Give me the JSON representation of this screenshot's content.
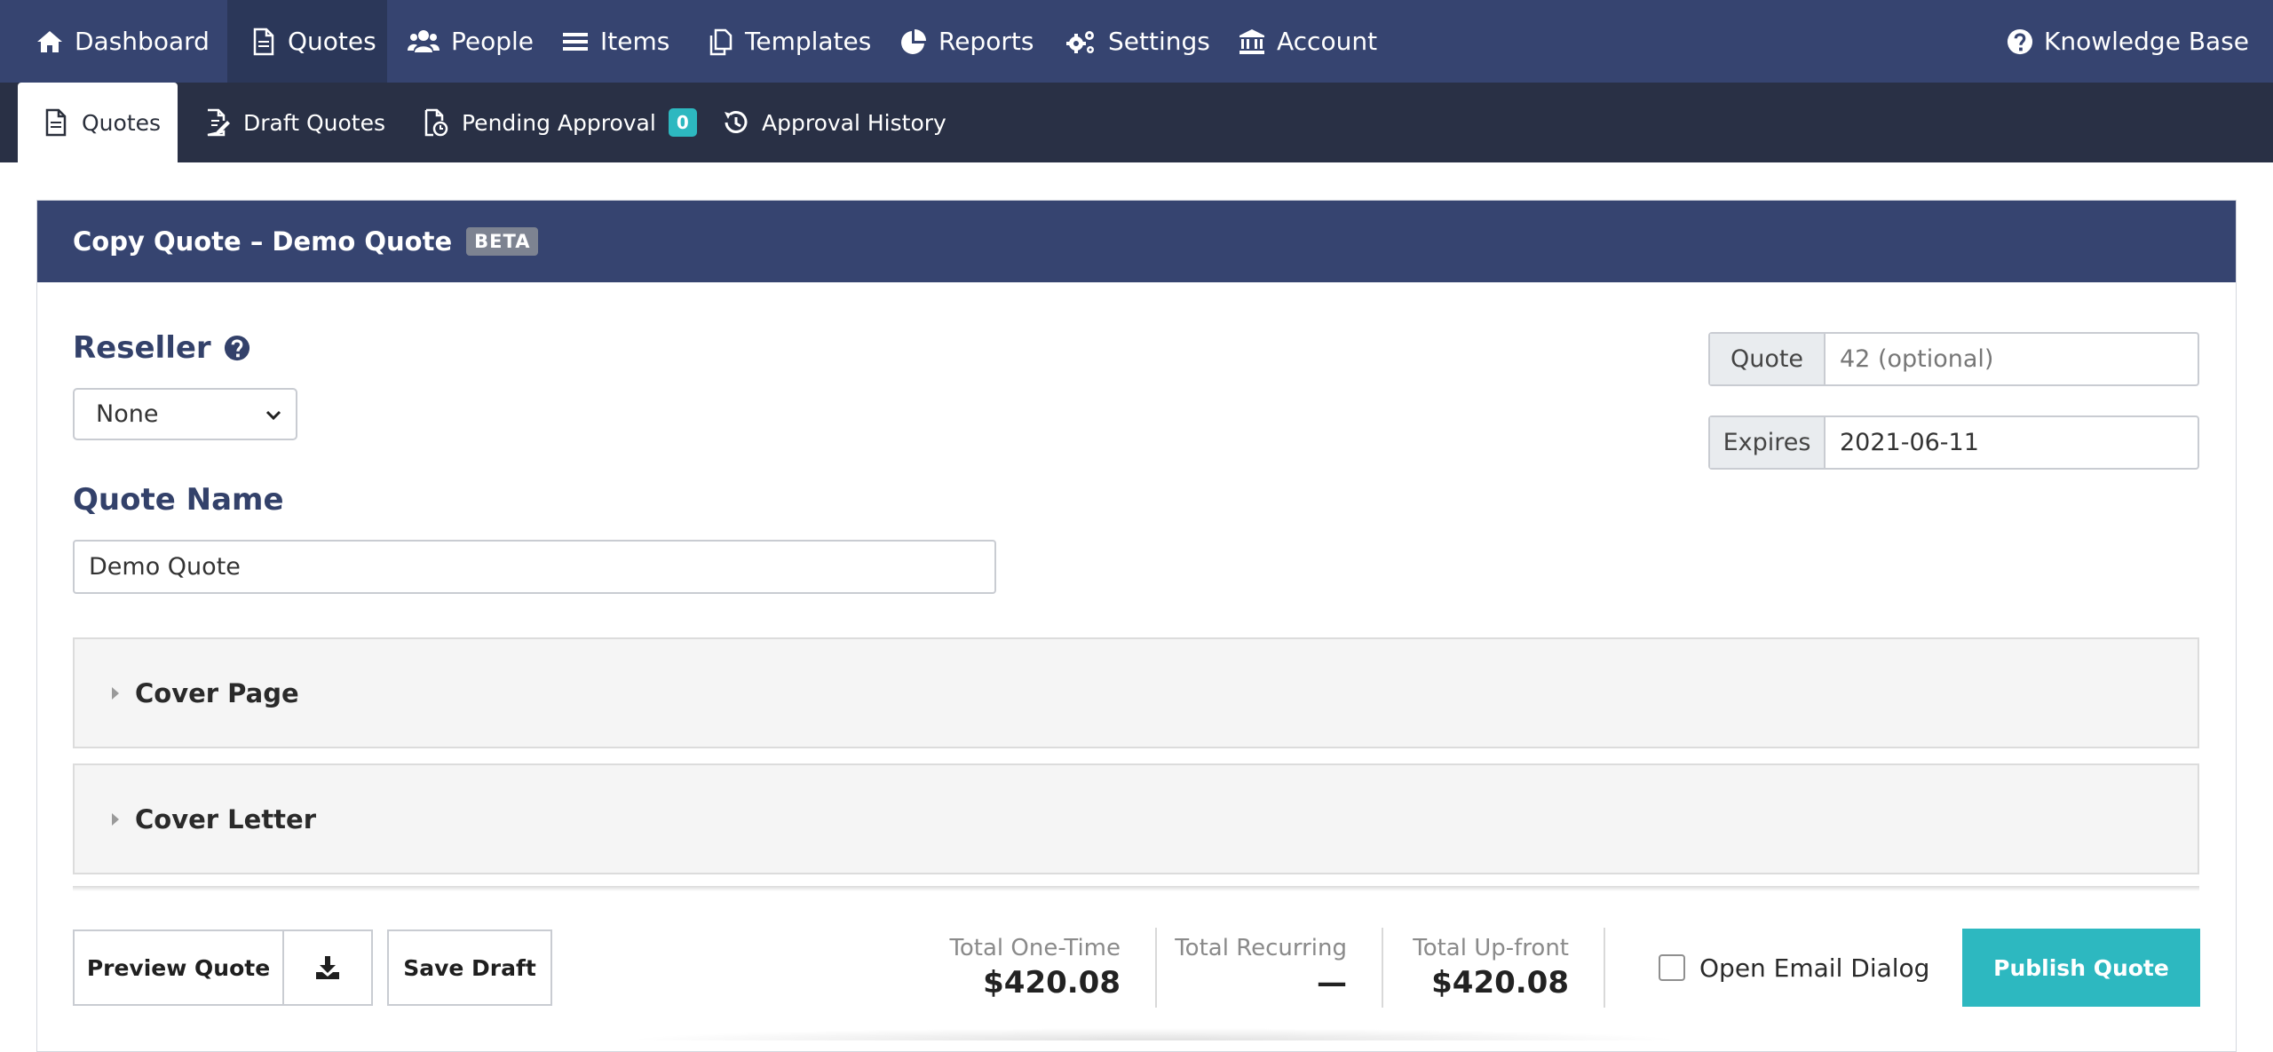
{
  "topnav": {
    "items": [
      {
        "label": "Dashboard",
        "icon": "home-icon"
      },
      {
        "label": "Quotes",
        "icon": "document-icon"
      },
      {
        "label": "People",
        "icon": "users-icon"
      },
      {
        "label": "Items",
        "icon": "list-icon"
      },
      {
        "label": "Templates",
        "icon": "copy-icon"
      },
      {
        "label": "Reports",
        "icon": "pie-chart-icon"
      },
      {
        "label": "Settings",
        "icon": "gears-icon"
      },
      {
        "label": "Account",
        "icon": "bank-icon"
      }
    ],
    "active": "Quotes",
    "knowledge_base": "Knowledge Base"
  },
  "subnav": {
    "items": [
      {
        "label": "Quotes",
        "icon": "document-icon"
      },
      {
        "label": "Draft Quotes",
        "icon": "edit-document-icon"
      },
      {
        "label": "Pending Approval",
        "icon": "clock-document-icon",
        "badge": "0"
      },
      {
        "label": "Approval History",
        "icon": "history-icon"
      }
    ],
    "active": "Quotes"
  },
  "card": {
    "title": "Copy Quote – Demo Quote",
    "beta": "BETA"
  },
  "form": {
    "reseller_label": "Reseller",
    "reseller_value": "None",
    "quote_name_label": "Quote Name",
    "quote_name_value": "Demo Quote",
    "quote_number_addon": "Quote",
    "quote_number_placeholder": "42 (optional)",
    "expires_addon": "Expires",
    "expires_value": "2021-06-11"
  },
  "sections": [
    {
      "title": "Cover Page"
    },
    {
      "title": "Cover Letter"
    }
  ],
  "footer": {
    "preview_label": "Preview Quote",
    "save_draft_label": "Save Draft",
    "total_one_time_label": "Total One-Time",
    "total_one_time_value": "$420.08",
    "total_recurring_label": "Total Recurring",
    "total_recurring_value": "—",
    "total_upfront_label": "Total Up-front",
    "total_upfront_value": "$420.08",
    "email_dialog_label": "Open Email Dialog",
    "publish_label": "Publish Quote"
  },
  "colors": {
    "nav_bg": "#364470",
    "subnav_bg": "#293045",
    "accent": "#2db8c0"
  }
}
